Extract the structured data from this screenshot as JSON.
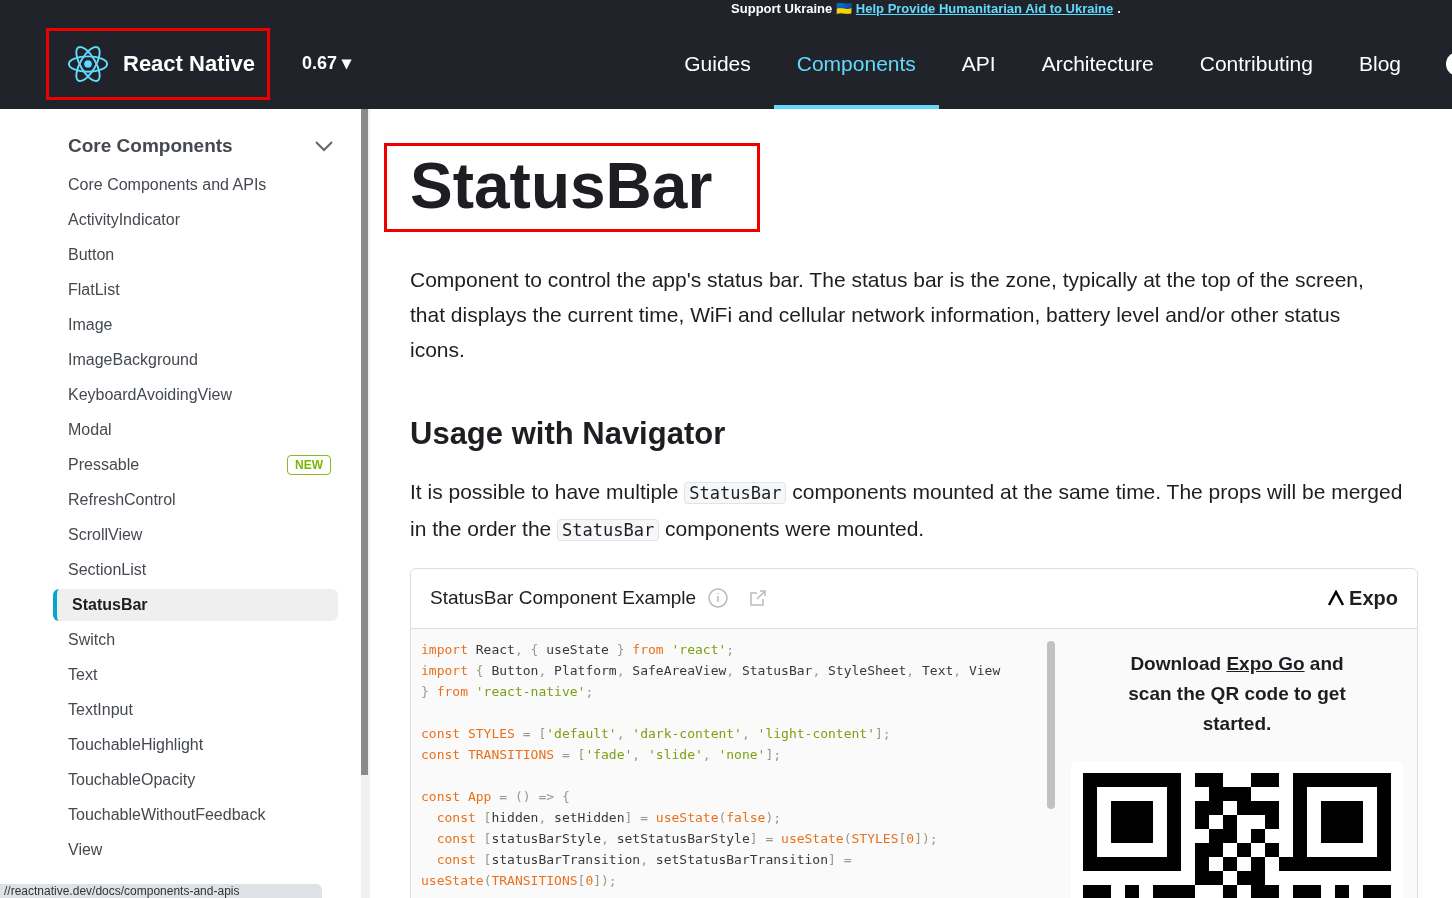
{
  "banner": {
    "text": "Support Ukraine 🇺🇦",
    "link": "Help Provide Humanitarian Aid to Ukraine",
    "end": "."
  },
  "navbar": {
    "brand": "React Native",
    "version": "0.67 ▾",
    "links": [
      {
        "label": "Guides",
        "selected": false
      },
      {
        "label": "Components",
        "selected": true
      },
      {
        "label": "API",
        "selected": false
      },
      {
        "label": "Architecture",
        "selected": false
      },
      {
        "label": "Contributing",
        "selected": false
      },
      {
        "label": "Blog",
        "selected": false
      }
    ]
  },
  "sidebar": {
    "category": "Core Components",
    "expanded": true,
    "items": [
      {
        "label": "Core Components and APIs",
        "selected": false
      },
      {
        "label": "ActivityIndicator",
        "selected": false
      },
      {
        "label": "Button",
        "selected": false
      },
      {
        "label": "FlatList",
        "selected": false
      },
      {
        "label": "Image",
        "selected": false
      },
      {
        "label": "ImageBackground",
        "selected": false
      },
      {
        "label": "KeyboardAvoidingView",
        "selected": false
      },
      {
        "label": "Modal",
        "selected": false
      },
      {
        "label": "Pressable",
        "selected": false,
        "badge": "NEW"
      },
      {
        "label": "RefreshControl",
        "selected": false
      },
      {
        "label": "ScrollView",
        "selected": false
      },
      {
        "label": "SectionList",
        "selected": false
      },
      {
        "label": "StatusBar",
        "selected": true
      },
      {
        "label": "Switch",
        "selected": false
      },
      {
        "label": "Text",
        "selected": false
      },
      {
        "label": "TextInput",
        "selected": false
      },
      {
        "label": "TouchableHighlight",
        "selected": false
      },
      {
        "label": "TouchableOpacity",
        "selected": false
      },
      {
        "label": "TouchableWithoutFeedback",
        "selected": false
      },
      {
        "label": "View",
        "selected": false
      }
    ]
  },
  "link_preview": "//reactnative.dev/docs/components-and-apis",
  "article": {
    "title": "StatusBar",
    "intro": "Component to control the app's status bar. The status bar is the zone, typically at the top of the screen, that displays the current time, WiFi and cellular network information, battery level and/or other status icons.",
    "section_heading": "Usage with Navigator",
    "paragraph": [
      {
        "kind": "text",
        "t": "It is possible to have multiple "
      },
      {
        "kind": "code",
        "t": "StatusBar"
      },
      {
        "kind": "text",
        "t": " components mounted at the same time. The props will be merged in the order the "
      },
      {
        "kind": "code",
        "t": "StatusBar"
      },
      {
        "kind": "text",
        "t": " components were mounted."
      }
    ]
  },
  "example": {
    "title": "StatusBar Component Example",
    "platform": "Expo",
    "code_blocks": [
      [
        [
          {
            "kind": "kw",
            "t": "import"
          },
          {
            "kind": "id",
            "t": " React"
          },
          {
            "kind": "p",
            "t": ", { "
          },
          {
            "kind": "id",
            "t": "useState"
          },
          {
            "kind": "p",
            "t": " } "
          },
          {
            "kind": "kw",
            "t": "from"
          },
          {
            "kind": "str",
            "t": " 'react'"
          },
          {
            "kind": "p",
            "t": ";"
          }
        ],
        [
          {
            "kind": "kw",
            "t": "import"
          },
          {
            "kind": "p",
            "t": " { "
          },
          {
            "kind": "id",
            "t": "Button"
          },
          {
            "kind": "p",
            "t": ", "
          },
          {
            "kind": "id",
            "t": "Platform"
          },
          {
            "kind": "p",
            "t": ", "
          },
          {
            "kind": "id",
            "t": "SafeAreaView"
          },
          {
            "kind": "p",
            "t": ", "
          },
          {
            "kind": "id",
            "t": "StatusBar"
          },
          {
            "kind": "p",
            "t": ", "
          },
          {
            "kind": "id",
            "t": "StyleSheet"
          },
          {
            "kind": "p",
            "t": ", "
          },
          {
            "kind": "id",
            "t": "Text"
          },
          {
            "kind": "p",
            "t": ", "
          },
          {
            "kind": "id",
            "t": "View"
          }
        ],
        [
          {
            "kind": "p",
            "t": "} "
          },
          {
            "kind": "kw",
            "t": "from"
          },
          {
            "kind": "str",
            "t": " 'react-native'"
          },
          {
            "kind": "p",
            "t": ";"
          }
        ]
      ],
      [
        [
          {
            "kind": "kw",
            "t": "const"
          },
          {
            "kind": "kw",
            "t": " STYLES"
          },
          {
            "kind": "p",
            "t": " = ["
          },
          {
            "kind": "str",
            "t": "'default'"
          },
          {
            "kind": "p",
            "t": ", "
          },
          {
            "kind": "str",
            "t": "'dark-content'"
          },
          {
            "kind": "p",
            "t": ", "
          },
          {
            "kind": "str",
            "t": "'light-content'"
          },
          {
            "kind": "p",
            "t": "];"
          }
        ],
        [
          {
            "kind": "kw",
            "t": "const"
          },
          {
            "kind": "kw",
            "t": " TRANSITIONS"
          },
          {
            "kind": "p",
            "t": " = ["
          },
          {
            "kind": "str",
            "t": "'fade'"
          },
          {
            "kind": "p",
            "t": ", "
          },
          {
            "kind": "str",
            "t": "'slide'"
          },
          {
            "kind": "p",
            "t": ", "
          },
          {
            "kind": "str",
            "t": "'none'"
          },
          {
            "kind": "p",
            "t": "];"
          }
        ]
      ],
      [
        [
          {
            "kind": "kw",
            "t": "const"
          },
          {
            "kind": "kw",
            "t": " App"
          },
          {
            "kind": "p",
            "t": " = () => {"
          }
        ],
        [
          {
            "kind": "kw",
            "t": "  const"
          },
          {
            "kind": "p",
            "t": " ["
          },
          {
            "kind": "id",
            "t": "hidden"
          },
          {
            "kind": "p",
            "t": ", "
          },
          {
            "kind": "id",
            "t": "setHidden"
          },
          {
            "kind": "p",
            "t": "] = "
          },
          {
            "kind": "kw",
            "t": "useState"
          },
          {
            "kind": "p",
            "t": "("
          },
          {
            "kind": "kw",
            "t": "false"
          },
          {
            "kind": "p",
            "t": ");"
          }
        ],
        [
          {
            "kind": "kw",
            "t": "  const"
          },
          {
            "kind": "p",
            "t": " ["
          },
          {
            "kind": "id",
            "t": "statusBarStyle"
          },
          {
            "kind": "p",
            "t": ", "
          },
          {
            "kind": "id",
            "t": "setStatusBarStyle"
          },
          {
            "kind": "p",
            "t": "] = "
          },
          {
            "kind": "kw",
            "t": "useState"
          },
          {
            "kind": "p",
            "t": "("
          },
          {
            "kind": "kw",
            "t": "STYLES"
          },
          {
            "kind": "p",
            "t": "["
          },
          {
            "kind": "kw",
            "t": "0"
          },
          {
            "kind": "p",
            "t": "]);"
          }
        ],
        [
          {
            "kind": "kw",
            "t": "  const"
          },
          {
            "kind": "p",
            "t": " ["
          },
          {
            "kind": "id",
            "t": "statusBarTransition"
          },
          {
            "kind": "p",
            "t": ", "
          },
          {
            "kind": "id",
            "t": "setStatusBarTransition"
          },
          {
            "kind": "p",
            "t": "] ="
          }
        ],
        [
          {
            "kind": "kw",
            "t": "useState"
          },
          {
            "kind": "p",
            "t": "("
          },
          {
            "kind": "kw",
            "t": "TRANSITIONS"
          },
          {
            "kind": "p",
            "t": "["
          },
          {
            "kind": "kw",
            "t": "0"
          },
          {
            "kind": "p",
            "t": "]);"
          }
        ]
      ]
    ],
    "qr_text": [
      {
        "kind": "text",
        "t": "Download "
      },
      {
        "kind": "link",
        "t": "Expo Go"
      },
      {
        "kind": "text",
        "t": " and scan the QR code to get started."
      }
    ]
  }
}
